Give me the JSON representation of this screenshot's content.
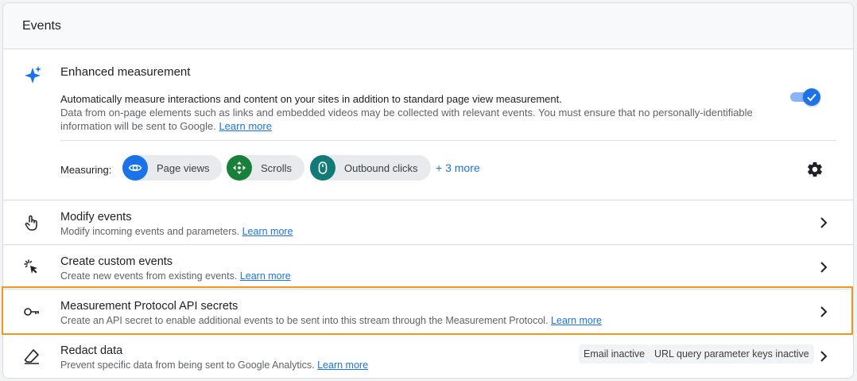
{
  "card_title": "Events",
  "enhanced": {
    "title": "Enhanced measurement",
    "desc_line1": "Automatically measure interactions and content on your sites in addition to standard page view measurement.",
    "desc_line2": "Data from on-page elements such as links and embedded videos may be collected with relevant events. You must ensure that no personally-identifiable information will be sent to Google.",
    "learn_more": "Learn more",
    "toggle_on": true,
    "measuring_label": "Measuring:",
    "chips": [
      {
        "label": "Page views",
        "icon": "eye-icon",
        "color": "#1a73e8"
      },
      {
        "label": "Scrolls",
        "icon": "scroll-arrows-icon",
        "color": "#188038"
      },
      {
        "label": "Outbound clicks",
        "icon": "mouse-icon",
        "color": "#137b77"
      }
    ],
    "more_link": "+ 3 more"
  },
  "rows": [
    {
      "title": "Modify events",
      "desc": "Modify incoming events and parameters.",
      "learn_more": "Learn more",
      "icon": "touch-hand-icon"
    },
    {
      "title": "Create custom events",
      "desc": "Create new events from existing events.",
      "learn_more": "Learn more",
      "icon": "cursor-click-icon"
    },
    {
      "title": "Measurement Protocol API secrets",
      "desc": "Create an API secret to enable additional events to be sent into this stream through the Measurement Protocol.",
      "learn_more": "Learn more",
      "icon": "key-icon"
    },
    {
      "title": "Redact data",
      "desc": "Prevent specific data from being sent to Google Analytics.",
      "learn_more": "Learn more",
      "icon": "eraser-icon",
      "badges": [
        "Email inactive",
        "URL query parameter keys inactive"
      ]
    }
  ],
  "colors": {
    "accent": "#1a73e8",
    "highlight": "#f7941d"
  }
}
